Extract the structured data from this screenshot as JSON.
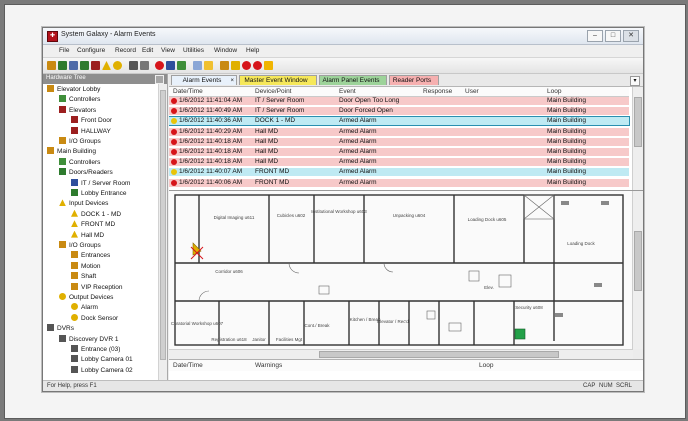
{
  "window": {
    "title": "System Galaxy - Alarm Events"
  },
  "menu": [
    "File",
    "Configure",
    "Record",
    "Edit",
    "View",
    "Utilities",
    "Window",
    "Help"
  ],
  "left_panel": {
    "title": "Hardware Tree"
  },
  "tree": [
    {
      "label": "Elevator Lobby",
      "icon": "building-icon",
      "color": "#c98a12"
    },
    {
      "label": "Controllers",
      "icon": "controller-icon",
      "color": "#3f8f3a"
    },
    {
      "label": "Elevators",
      "icon": "elevator-icon",
      "color": "#9c1f1f"
    },
    {
      "label": "Front Door",
      "icon": "door-icon",
      "color": "#9c1f1f"
    },
    {
      "label": "HALLWAY",
      "icon": "door-icon",
      "color": "#9c1f1f"
    },
    {
      "label": "I/O Groups",
      "icon": "io-group-icon",
      "color": "#c98a12"
    },
    {
      "label": "Main Building",
      "icon": "building-icon",
      "color": "#c98a12"
    },
    {
      "label": "Controllers",
      "icon": "controller-icon",
      "color": "#3f8f3a"
    },
    {
      "label": "Doors/Readers",
      "icon": "reader-icon",
      "color": "#2e7b2e"
    },
    {
      "label": "IT / Server Room",
      "icon": "door-icon",
      "color": "#2e4f9c"
    },
    {
      "label": "Lobby Entrance",
      "icon": "door-icon",
      "color": "#2e7b2e"
    },
    {
      "label": "Input Devices",
      "icon": "warning-icon",
      "color": "#e0b000"
    },
    {
      "label": "DOCK 1 - MD",
      "icon": "warning-icon",
      "color": "#e0b000"
    },
    {
      "label": "FRONT MD",
      "icon": "warning-icon",
      "color": "#e0b000"
    },
    {
      "label": "Hall MD",
      "icon": "warning-icon",
      "color": "#e0b000"
    },
    {
      "label": "I/O Groups",
      "icon": "io-group-icon",
      "color": "#c98a12"
    },
    {
      "label": "Entrances",
      "icon": "io-group-icon",
      "color": "#c98a12"
    },
    {
      "label": "Motion",
      "icon": "io-group-icon",
      "color": "#c98a12"
    },
    {
      "label": "Shaft",
      "icon": "io-group-icon",
      "color": "#c98a12"
    },
    {
      "label": "VIP Reception",
      "icon": "io-group-icon",
      "color": "#c98a12"
    },
    {
      "label": "Output Devices",
      "icon": "bulb-icon",
      "color": "#e0b000"
    },
    {
      "label": "Alarm",
      "icon": "bulb-icon",
      "color": "#e0b000"
    },
    {
      "label": "Dock Sensor",
      "icon": "bulb-icon",
      "color": "#e0b000"
    },
    {
      "label": "DVRs",
      "icon": "dvr-icon",
      "color": "#555555"
    },
    {
      "label": "Discovery DVR 1",
      "icon": "dvr-icon",
      "color": "#555555"
    },
    {
      "label": "Entrance (03)",
      "icon": "camera-icon",
      "color": "#555555"
    },
    {
      "label": "Lobby Camera 01",
      "icon": "camera-icon",
      "color": "#555555"
    },
    {
      "label": "Lobby Camera 02",
      "icon": "camera-icon",
      "color": "#555555"
    }
  ],
  "tabs": [
    {
      "label": "Alarm Events",
      "color": "#e8f1fb",
      "active": true
    },
    {
      "label": "Master Event Window",
      "color": "#f6e85a"
    },
    {
      "label": "Alarm Panel Events",
      "color": "#9dd39a"
    },
    {
      "label": "Reader Ports",
      "color": "#f6b0b0"
    }
  ],
  "event_columns": [
    "Date/Time",
    "Device/Point",
    "Event",
    "Response",
    "User",
    "Loop"
  ],
  "events": [
    {
      "datetime": "1/6/2012 11:41:04 AM",
      "device": "IT / Server Room",
      "event": "Door Open Too Long",
      "loop": "Main Building",
      "bg": "#f7c9c9",
      "dot": "#d6141a"
    },
    {
      "datetime": "1/6/2012 11:40:49 AM",
      "device": "IT / Server Room",
      "event": "Door Forced Open",
      "loop": "Main Building",
      "bg": "#f7c9c9",
      "dot": "#d6141a"
    },
    {
      "datetime": "1/6/2012 11:40:36 AM",
      "device": "DOCK 1 - MD",
      "event": "Armed Alarm",
      "loop": "Main Building",
      "bg": "#bfeaf3",
      "dot": "#e8c40a"
    },
    {
      "datetime": "1/6/2012 11:40:29 AM",
      "device": "Hall MD",
      "event": "Armed Alarm",
      "loop": "Main Building",
      "bg": "#f7c9c9",
      "dot": "#d6141a"
    },
    {
      "datetime": "1/6/2012 11:40:18 AM",
      "device": "Hall MD",
      "event": "Armed Alarm",
      "loop": "Main Building",
      "bg": "#f7c9c9",
      "dot": "#d6141a"
    },
    {
      "datetime": "1/6/2012 11:40:18 AM",
      "device": "Hall MD",
      "event": "Armed Alarm",
      "loop": "Main Building",
      "bg": "#f7c9c9",
      "dot": "#d6141a"
    },
    {
      "datetime": "1/6/2012 11:40:18 AM",
      "device": "Hall MD",
      "event": "Armed Alarm",
      "loop": "Main Building",
      "bg": "#f7c9c9",
      "dot": "#d6141a"
    },
    {
      "datetime": "1/6/2012 11:40:07 AM",
      "device": "FRONT MD",
      "event": "Armed Alarm",
      "loop": "Main Building",
      "bg": "#bfeaf3",
      "dot": "#e8c40a"
    },
    {
      "datetime": "1/6/2012 11:40:06 AM",
      "device": "FRONT MD",
      "event": "Armed Alarm",
      "loop": "Main Building",
      "bg": "#f7c9c9",
      "dot": "#d6141a"
    }
  ],
  "map_rooms": [
    "Digital Imaging u611",
    "Cubicles u602",
    "Institutional Workshop u603",
    "Unpacking u604",
    "Loading Dock u605",
    "Loading Dock",
    "Corridor u606",
    "Curatorial Workshop u607",
    "Cont./ Break",
    "Kitchen / Break",
    "Elevator / Rec'd",
    "Security u608",
    "Registration u618",
    "Facilities Mgt",
    "Janitor",
    "Elev."
  ],
  "bottom_columns": [
    "Date/Time",
    "Warnings",
    "Loop"
  ],
  "status": {
    "help": "For Help, press F1",
    "indicators": [
      "CAP",
      "NUM",
      "SCRL"
    ]
  }
}
